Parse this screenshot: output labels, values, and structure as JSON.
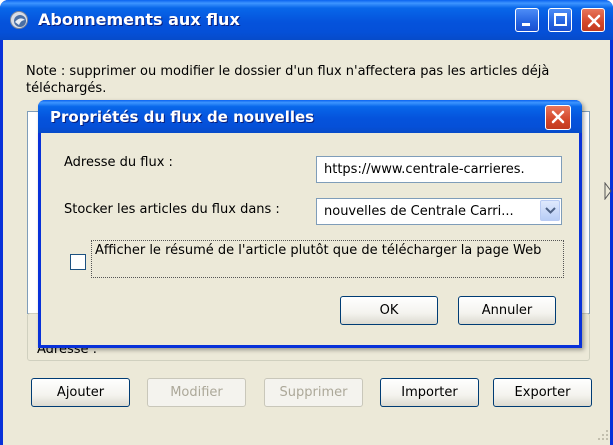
{
  "outer_window": {
    "title": "Abonnements aux flux",
    "note": "Note : supprimer ou modifier le dossier d'un flux n'affectera pas les articles déjà téléchargés.",
    "address_label": "Adresse :",
    "buttons": {
      "add": "Ajouter",
      "modify": "Modifier",
      "delete": "Supprimer",
      "import": "Importer",
      "export": "Exporter"
    },
    "disabled_buttons": [
      "Modifier",
      "Supprimer"
    ]
  },
  "dialog": {
    "title": "Propriétés du flux de nouvelles",
    "feed_address_label": "Adresse du flux :",
    "feed_address_value": "https://www.centrale-carrieres.",
    "store_label": "Stocker les articles du flux dans :",
    "store_value": "nouvelles de Centrale Carri...",
    "checkbox_label": "Afficher le résumé de l'article plutôt que de télécharger la page Web",
    "checkbox_checked": false,
    "ok_label": "OK",
    "cancel_label": "Annuler"
  },
  "icons": {
    "app": "thunderbird-icon",
    "minimize": "minimize-icon",
    "maximize": "maximize-icon",
    "close": "close-icon",
    "combo": "chevron-down-icon"
  },
  "colors": {
    "titlebar": "#0553dc",
    "window_bg": "#ece9d8",
    "close_button": "#d4472a"
  }
}
